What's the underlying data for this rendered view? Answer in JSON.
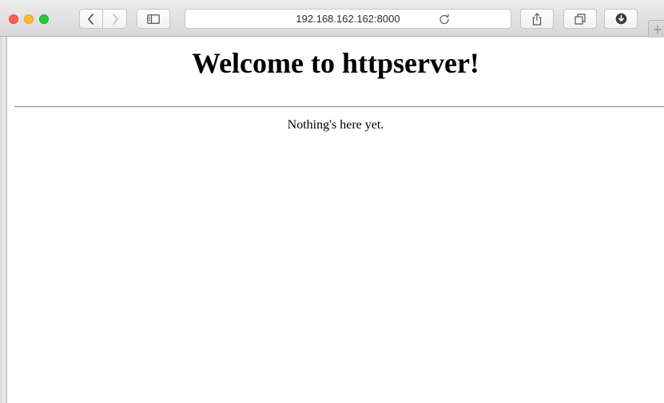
{
  "browser": {
    "address_bar": {
      "url": "192.168.162.162:8000"
    },
    "icons": {
      "back": "chevron-left-icon",
      "forward": "chevron-right-icon",
      "sidebar": "sidebar-icon",
      "reload": "reload-icon",
      "share": "share-icon",
      "tabs": "tabs-overview-icon",
      "download": "download-icon",
      "new_tab": "plus-icon"
    },
    "colors": {
      "close": "#fc5f57",
      "minimize": "#fdbc2e",
      "zoom": "#28c840"
    }
  },
  "page": {
    "heading": "Welcome to httpserver!",
    "message": "Nothing's here yet."
  }
}
